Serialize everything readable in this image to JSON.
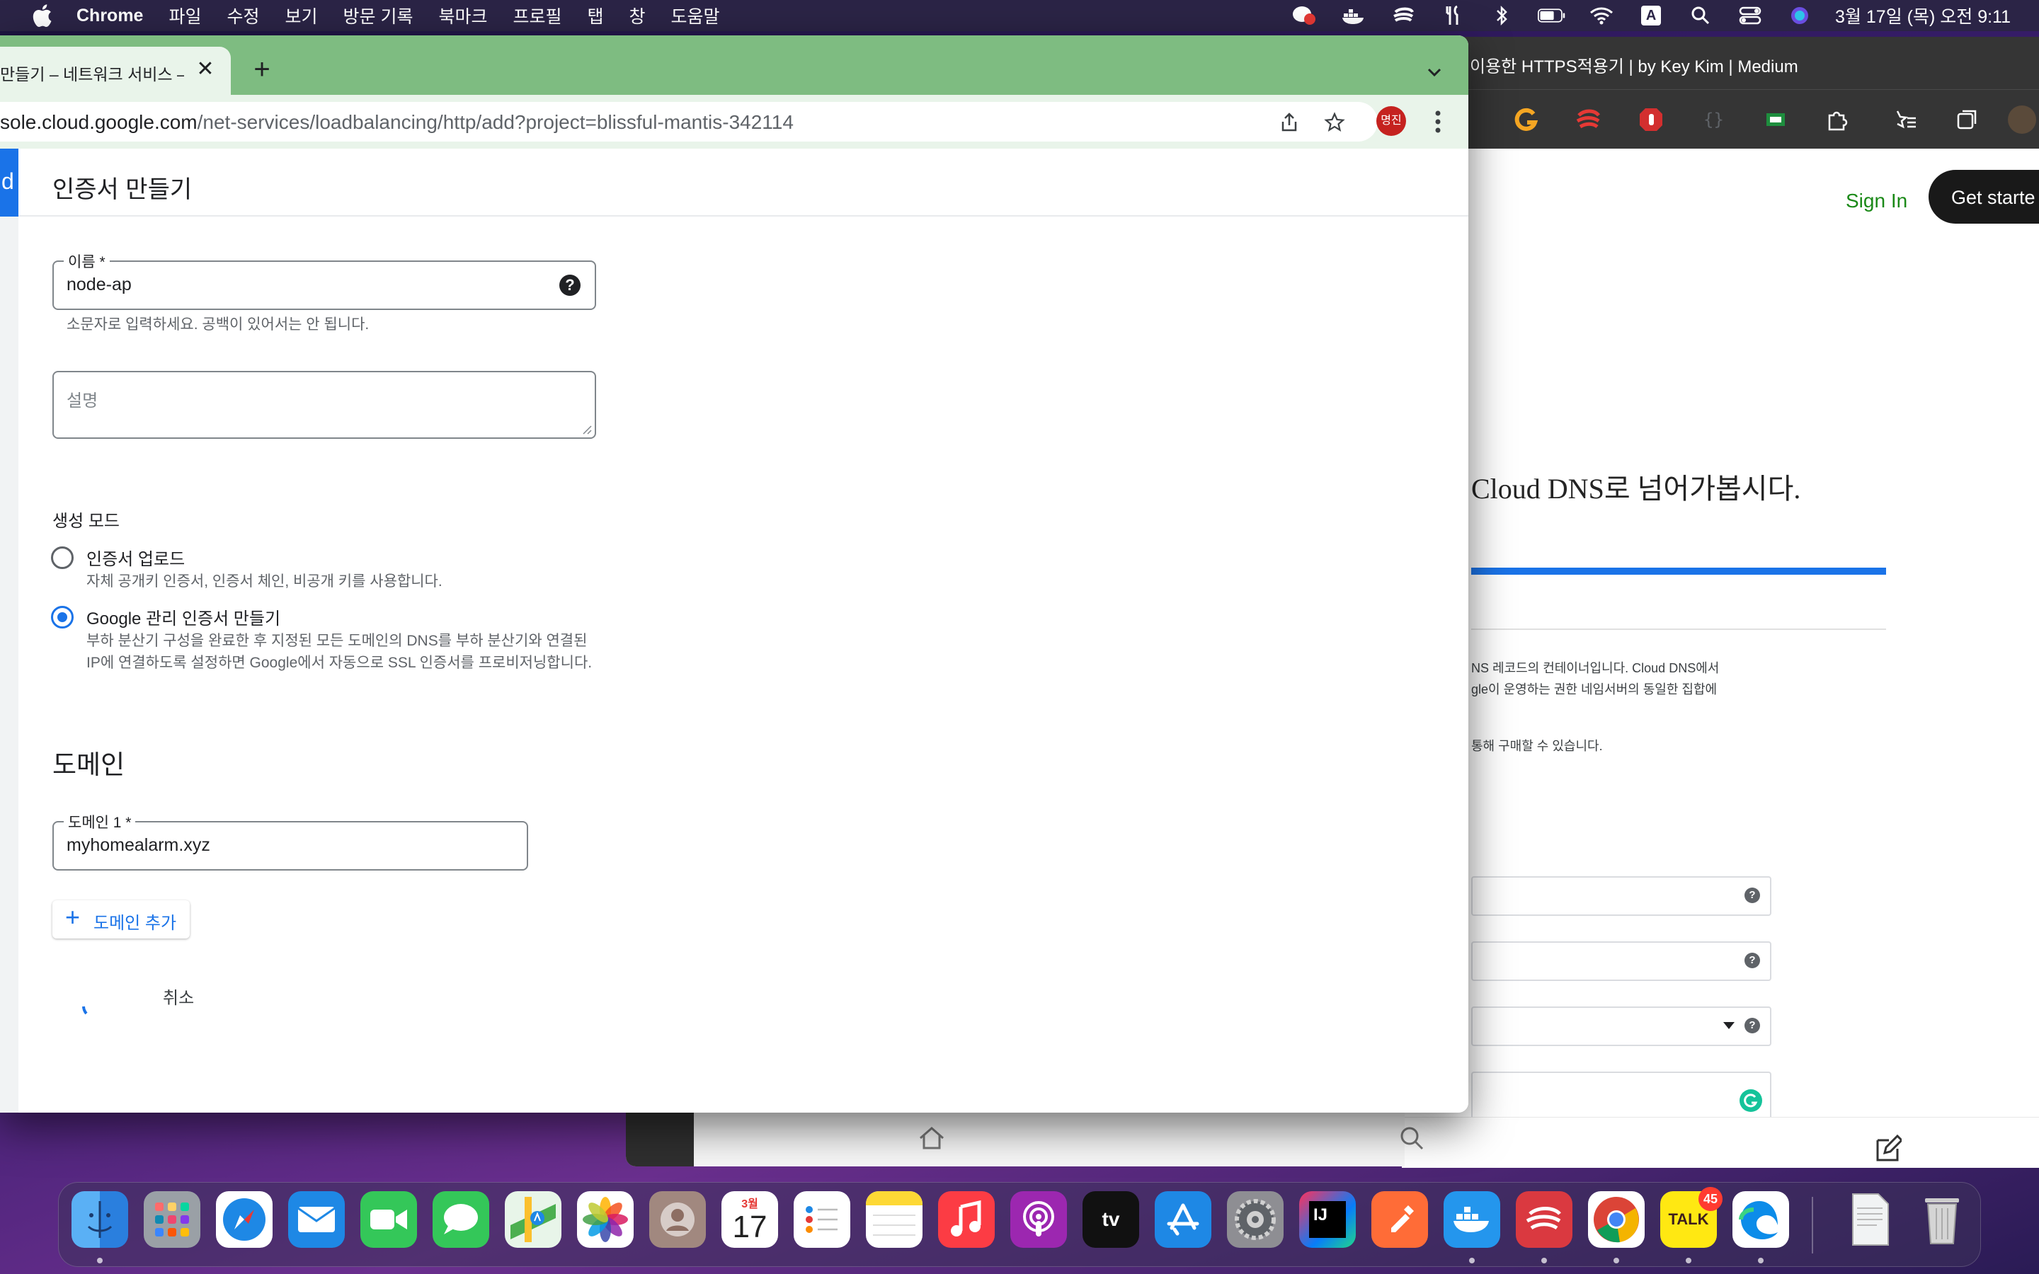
{
  "menubar": {
    "app_name": "Chrome",
    "items": [
      "파일",
      "수정",
      "보기",
      "방문 기록",
      "북마크",
      "프로필",
      "탭",
      "창",
      "도움말"
    ],
    "input_source": "A",
    "clock": "3월 17일 (목) 오전 9:11"
  },
  "chrome": {
    "tab_title": "만들기 – 네트워크 서비스 – N",
    "url_host": "sole.cloud.google.com",
    "url_path": "/net-services/loadbalancing/http/add?project=blissful-mantis-342114",
    "profile_label": "명진",
    "page_title": "인증서 만들기",
    "left_strip_letter": "d",
    "form": {
      "name_label": "이름 *",
      "name_value": "node-ap",
      "name_hint": "소문자로 입력하세요. 공백이 있어서는 안 됩니다.",
      "description_placeholder": "설명",
      "mode_label": "생성 모드",
      "options": [
        {
          "label": "인증서 업로드",
          "desc": "자체 공개키 인증서, 인증서 체인, 비공개 키를 사용합니다.",
          "checked": false
        },
        {
          "label": "Google 관리 인증서 만들기",
          "desc": "부하 분산기 구성을 완료한 후 지정된 모든 도메인의 DNS를 부하 분산기와 연결된 IP에 연결하도록 설정하면 Google에서 자동으로 SSL 인증서를 프로비저닝합니다.",
          "checked": true
        }
      ],
      "domain_heading": "도메인",
      "domain1_label": "도메인 1 *",
      "domain1_value": "myhomealarm.xyz",
      "add_domain_label": "도메인 추가",
      "cancel_label": "취소"
    }
  },
  "medium": {
    "tab_title": "이용한 HTTPS적용기 | by Key Kim | Medium",
    "sign_in": "Sign In",
    "get_started": "Get starte",
    "heading": "Cloud DNS로 넘어가봅시다.",
    "text1": "NS 레코드의 컨테이너입니다. Cloud DNS에서",
    "text2": "gle이 운영하는 권한 네임서버의 동일한 집합에",
    "text3": "통해 구매할 수 있습니다."
  },
  "dock": {
    "calendar_month": "3월",
    "calendar_day": "17",
    "kakao_badge": "45"
  },
  "colors": {
    "chrome_tab_strip": "#7ebc81",
    "chrome_toolbar": "#e9f4ea",
    "accent": "#1a73e8",
    "profile": "#c5221f",
    "medium_green": "#1a8917"
  }
}
